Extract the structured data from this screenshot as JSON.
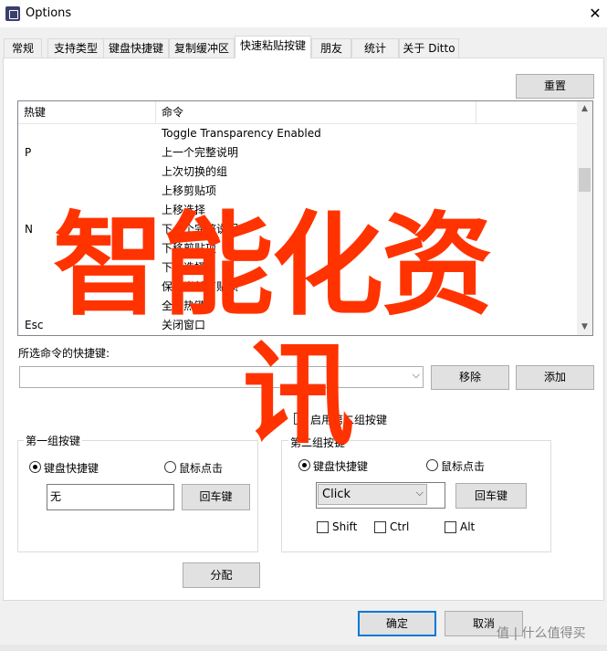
{
  "window": {
    "title": "Options",
    "close_glyph": "✕"
  },
  "tabs": [
    {
      "label": "常规"
    },
    {
      "label": "支持类型"
    },
    {
      "label": "键盘快捷键"
    },
    {
      "label": "复制缓冲区"
    },
    {
      "label": "快速粘贴按键"
    },
    {
      "label": "朋友"
    },
    {
      "label": "统计"
    },
    {
      "label": "关于 Ditto"
    }
  ],
  "active_tab": "快速粘贴按键",
  "reset_button": "重置",
  "list": {
    "columns": [
      "热键",
      "命令"
    ],
    "rows": [
      {
        "hotkey": "",
        "command": "Toggle Transparency Enabled"
      },
      {
        "hotkey": "P",
        "command": "上一个完整说明"
      },
      {
        "hotkey": "",
        "command": "上次切换的组"
      },
      {
        "hotkey": "",
        "command": "上移剪贴项"
      },
      {
        "hotkey": "",
        "command": "上移选择"
      },
      {
        "hotkey": "N",
        "command": "下一个完整说明"
      },
      {
        "hotkey": "",
        "command": "下移剪贴项"
      },
      {
        "hotkey": "",
        "command": "下移选择"
      },
      {
        "hotkey": "",
        "command": "保存当前剪贴项"
      },
      {
        "hotkey": "",
        "command": "全局热键"
      },
      {
        "hotkey": "Esc",
        "command": "关闭窗口"
      }
    ]
  },
  "selected_shortcut_label": "所选命令的快捷键:",
  "remove_button": "移除",
  "add_button": "添加",
  "enable_second_group": "启用第二组按键",
  "group1": {
    "title": "第一组按键",
    "radio_keyboard": "键盘快捷键",
    "radio_mouse": "鼠标点击",
    "key_value": "无",
    "enter_button": "回车键"
  },
  "group2": {
    "title": "第二组按键",
    "radio_keyboard": "键盘快捷键",
    "radio_mouse": "鼠标点击",
    "mouse_select": "Click",
    "enter_button": "回车键",
    "shift": "Shift",
    "ctrl": "Ctrl",
    "alt": "Alt"
  },
  "assign_button": "分配",
  "ok_button": "确定",
  "cancel_button": "取消",
  "watermark_line1": "智能化资",
  "watermark_line2": "讯",
  "site_watermark": "值 | 什么值得买",
  "colors": {
    "accent": "#0078d7",
    "watermark": "#ff3300"
  }
}
